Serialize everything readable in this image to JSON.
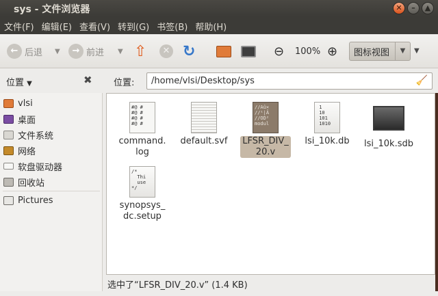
{
  "window": {
    "title": "sys - 文件浏览器"
  },
  "menu": [
    "文件(F)",
    "编辑(E)",
    "查看(V)",
    "转到(G)",
    "书签(B)",
    "帮助(H)"
  ],
  "toolbar": {
    "back_label": "后退",
    "forward_label": "前进",
    "zoom_level": "100%",
    "view_mode": "图标视图"
  },
  "sidebar": {
    "header": "位置",
    "items": [
      {
        "label": "vlsi",
        "icon": "home-folder-icon"
      },
      {
        "label": "桌面",
        "icon": "desktop-icon"
      },
      {
        "label": "文件系统",
        "icon": "filesystem-icon"
      },
      {
        "label": "网络",
        "icon": "network-icon"
      },
      {
        "label": "软盘驱动器",
        "icon": "floppy-icon"
      },
      {
        "label": "回收站",
        "icon": "trash-icon"
      },
      {
        "label": "Pictures",
        "icon": "pictures-folder-icon"
      }
    ]
  },
  "location": {
    "label": "位置:",
    "path": "/home/vlsi/Desktop/sys"
  },
  "files": [
    {
      "name": "command.\nlog",
      "preview": "#@ #\n#@ #\n#@ #\n#@ #"
    },
    {
      "name": "default.svf",
      "preview": ""
    },
    {
      "name": "LFSR_DIV_\n20.v",
      "preview": "//Aû×\n//¹|Â\n//OD²\nmodul",
      "selected": true
    },
    {
      "name": "lsi_10k.db",
      "preview": " 1\n 10\n 101\n 1010"
    },
    {
      "name": "lsi_10k.sdb",
      "preview": ""
    },
    {
      "name": "synopsys_\ndc.setup",
      "preview": "/*\n  Thi\n  use\n*/"
    }
  ],
  "status": "选中了“LFSR_DIV_20.v” (1.4 KB)"
}
